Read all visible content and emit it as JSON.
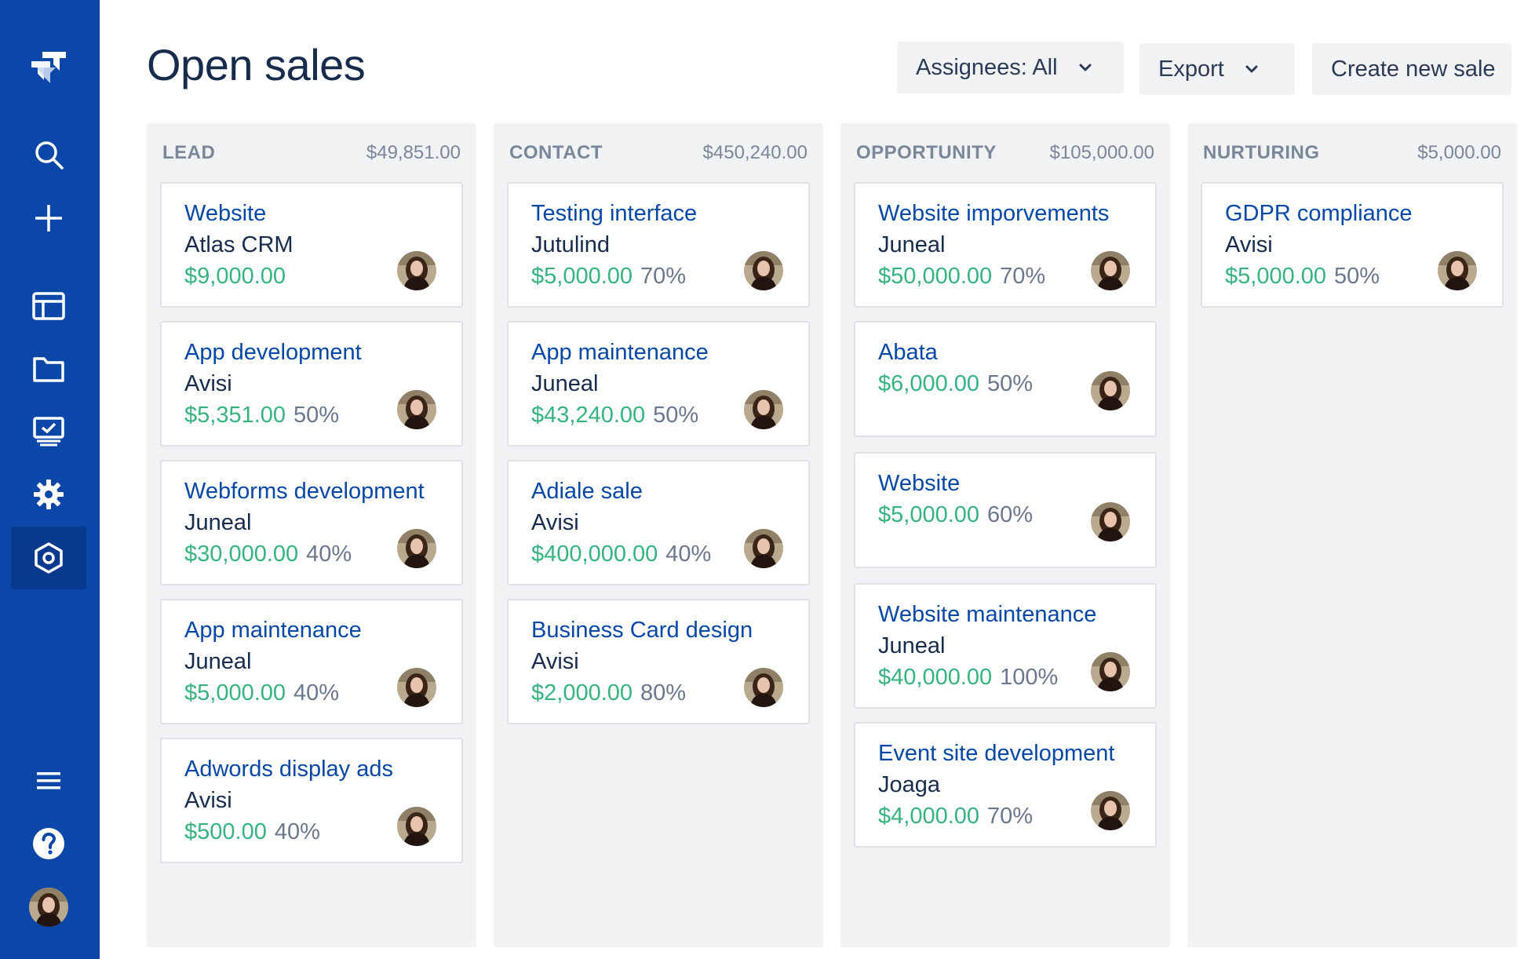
{
  "page": {
    "title": "Open sales"
  },
  "header": {
    "assignees_label": "Assignees: All",
    "export_label": "Export",
    "create_label": "Create new sale"
  },
  "colors": {
    "sidebar": "#0a47a8",
    "link": "#0747a6",
    "amount": "#36b37e",
    "muted": "#6b778c",
    "column_bg": "#f1f2f4"
  },
  "sidebar": {
    "items": [
      "jira-logo-icon",
      "search-icon",
      "plus-icon",
      "board-icon",
      "folder-icon",
      "monitor-check-icon",
      "gear-icon",
      "hexagon-settings-icon",
      "menu-icon",
      "help-icon",
      "avatar"
    ]
  },
  "columns": [
    {
      "name": "LEAD",
      "total": "$49,851.00",
      "cards": [
        {
          "title": "Website",
          "company": "Atlas CRM",
          "amount": "$9,000.00",
          "percent": ""
        },
        {
          "title": "App development",
          "company": "Avisi",
          "amount": "$5,351.00",
          "percent": "50%"
        },
        {
          "title": "Webforms development",
          "company": "Juneal",
          "amount": "$30,000.00",
          "percent": "40%"
        },
        {
          "title": "App maintenance",
          "company": "Juneal",
          "amount": "$5,000.00",
          "percent": "40%"
        },
        {
          "title": "Adwords display ads",
          "company": "Avisi",
          "amount": "$500.00",
          "percent": "40%"
        }
      ]
    },
    {
      "name": "CONTACT",
      "total": "$450,240.00",
      "cards": [
        {
          "title": "Testing interface",
          "company": "Jutulind",
          "amount": "$5,000.00",
          "percent": "70%"
        },
        {
          "title": "App maintenance",
          "company": "Juneal",
          "amount": "$43,240.00",
          "percent": "50%"
        },
        {
          "title": "Adiale sale",
          "company": "Avisi",
          "amount": "$400,000.00",
          "percent": "40%"
        },
        {
          "title": "Business Card design",
          "company": "Avisi",
          "amount": "$2,000.00",
          "percent": "80%"
        }
      ]
    },
    {
      "name": "OPPORTUNITY",
      "total": "$105,000.00",
      "cards": [
        {
          "title": "Website imporvements",
          "company": "Juneal",
          "amount": "$50,000.00",
          "percent": "70%"
        },
        {
          "title": "Abata",
          "company": "",
          "amount": "$6,000.00",
          "percent": "50%"
        },
        {
          "title": "Website",
          "company": "",
          "amount": "$5,000.00",
          "percent": "60%"
        },
        {
          "title": "Website maintenance",
          "company": "Juneal",
          "amount": "$40,000.00",
          "percent": "100%"
        },
        {
          "title": "Event site development",
          "company": "Joaga",
          "amount": "$4,000.00",
          "percent": "70%"
        }
      ]
    },
    {
      "name": "NURTURING",
      "total": "$5,000.00",
      "cards": [
        {
          "title": "GDPR compliance",
          "company": "Avisi",
          "amount": "$5,000.00",
          "percent": "50%"
        }
      ]
    }
  ]
}
